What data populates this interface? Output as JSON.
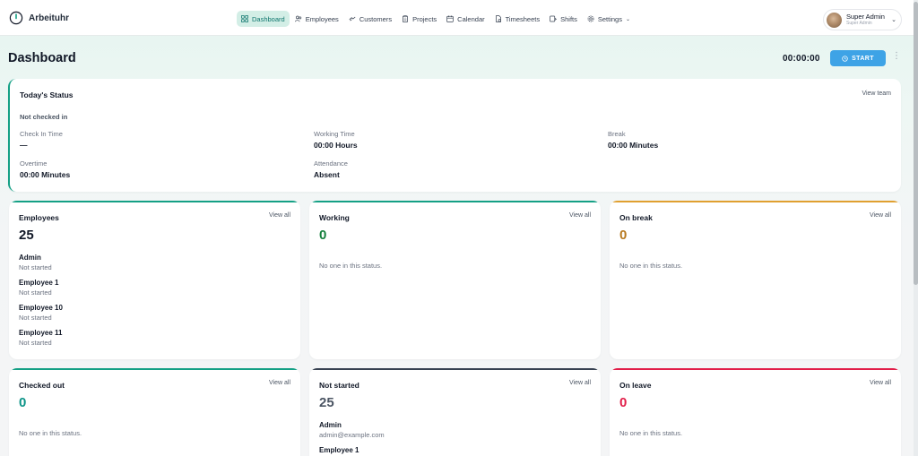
{
  "app": {
    "name": "Arbeituhr"
  },
  "nav": {
    "items": [
      {
        "label": "Dashboard",
        "icon": "grid-icon",
        "active": true
      },
      {
        "label": "Employees",
        "icon": "users-icon",
        "active": false
      },
      {
        "label": "Customers",
        "icon": "handshake-icon",
        "active": false
      },
      {
        "label": "Projects",
        "icon": "clipboard-icon",
        "active": false
      },
      {
        "label": "Calendar",
        "icon": "calendar-icon",
        "active": false
      },
      {
        "label": "Timesheets",
        "icon": "timesheet-icon",
        "active": false
      },
      {
        "label": "Shifts",
        "icon": "shifts-icon",
        "active": false
      },
      {
        "label": "Settings",
        "icon": "gear-icon",
        "active": false
      }
    ]
  },
  "user": {
    "name": "Super Admin",
    "role": "Super Admin"
  },
  "header": {
    "title": "Dashboard",
    "timer": "00:00:00",
    "start_label": "START"
  },
  "status": {
    "title": "Today's Status",
    "view_label": "View team",
    "state": "Not checked in",
    "fields": {
      "check_in": {
        "label": "Check In Time",
        "value": "—"
      },
      "working": {
        "label": "Working Time",
        "value": "00:00 Hours"
      },
      "break": {
        "label": "Break",
        "value": "00:00 Minutes"
      },
      "overtime": {
        "label": "Overtime",
        "value": "00:00 Minutes"
      },
      "attendance": {
        "label": "Attendance",
        "value": "Absent"
      }
    }
  },
  "cards": {
    "employees": {
      "title": "Employees",
      "view": "View all",
      "count": "25",
      "accent": "#14a085",
      "people": [
        {
          "name": "Admin",
          "sub": "Not started"
        },
        {
          "name": "Employee 1",
          "sub": "Not started"
        },
        {
          "name": "Employee 10",
          "sub": "Not started"
        },
        {
          "name": "Employee 11",
          "sub": "Not started"
        }
      ]
    },
    "working": {
      "title": "Working",
      "view": "View all",
      "count": "0",
      "empty": "No one in this status.",
      "accent": "#14a085",
      "count_color": "#15803d"
    },
    "on_break": {
      "title": "On break",
      "view": "View all",
      "count": "0",
      "empty": "No one in this status.",
      "accent": "#e0a030",
      "count_color": "#b7791f"
    },
    "checked_out": {
      "title": "Checked out",
      "view": "View all",
      "count": "0",
      "empty": "No one in this status.",
      "accent": "#14a085",
      "count_color": "#0d9488"
    },
    "not_started": {
      "title": "Not started",
      "view": "View all",
      "count": "25",
      "accent": "#374151",
      "count_color": "#4b5563",
      "people": [
        {
          "name": "Admin",
          "sub": "admin@example.com"
        },
        {
          "name": "Employee 1",
          "sub": ""
        }
      ]
    },
    "on_leave": {
      "title": "On leave",
      "view": "View all",
      "count": "0",
      "empty": "No one in this status.",
      "accent": "#e11d48",
      "count_color": "#e11d48"
    }
  }
}
